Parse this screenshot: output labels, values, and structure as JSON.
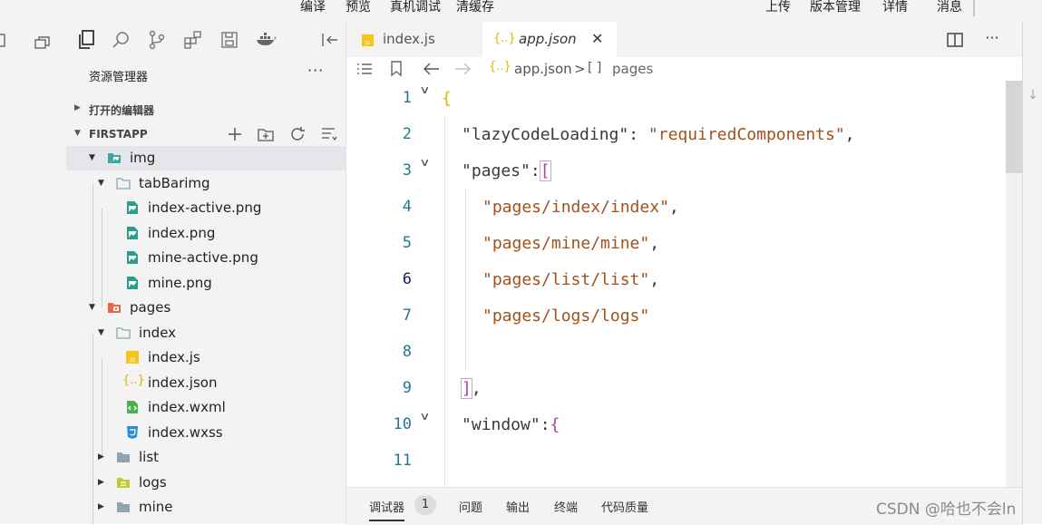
{
  "toolbar": {
    "compile": "编译",
    "preview": "预览",
    "real_debug": "真机调试",
    "clear_cache": "清缓存",
    "upload": "上传",
    "version_mgmt": "版本管理",
    "details": "详情",
    "messages": "消息"
  },
  "sidebar": {
    "title": "资源管理器",
    "more": "···",
    "open_editors": "打开的编辑器",
    "project": "FIRSTAPP",
    "tree": [
      {
        "label": "img",
        "type": "folder",
        "expanded": true
      },
      {
        "label": "tabBarimg",
        "type": "folder",
        "expanded": true
      },
      {
        "label": "index-active.png",
        "type": "image"
      },
      {
        "label": "index.png",
        "type": "image"
      },
      {
        "label": "mine-active.png",
        "type": "image"
      },
      {
        "label": "mine.png",
        "type": "image"
      },
      {
        "label": "pages",
        "type": "folder",
        "expanded": true
      },
      {
        "label": "index",
        "type": "folder",
        "expanded": true
      },
      {
        "label": "index.js",
        "type": "js"
      },
      {
        "label": "index.json",
        "type": "json"
      },
      {
        "label": "index.wxml",
        "type": "wxml"
      },
      {
        "label": "index.wxss",
        "type": "wxss"
      },
      {
        "label": "list",
        "type": "folder",
        "expanded": false
      },
      {
        "label": "logs",
        "type": "folder",
        "expanded": false
      },
      {
        "label": "mine",
        "type": "folder",
        "expanded": false
      }
    ]
  },
  "editor": {
    "tabs": [
      {
        "label": "index.js",
        "icon": "js-icon"
      },
      {
        "label": "app.json",
        "icon": "json-icon",
        "active": true
      }
    ],
    "breadcrumb": {
      "file": "app.json",
      "sep": ">",
      "node": "pages",
      "node_icon": "[ ]"
    },
    "line_numbers": [
      "1",
      "2",
      "3",
      "4",
      "5",
      "6",
      "7",
      "8",
      "9",
      "10",
      "11"
    ],
    "active_line": "6",
    "code": {
      "l1": "{",
      "l2_key": "\"lazyCodeLoading\"",
      "l2_colon": ": ",
      "l2_val": "\"requiredComponents\"",
      "l2_comma": ",",
      "l3_key": "\"pages\"",
      "l3_colon": ":",
      "l3_bracket": "[",
      "l4": "\"pages/index/index\"",
      "l5": "\"pages/mine/mine\"",
      "l6": "\"pages/list/list\"",
      "l7": "\"pages/logs/logs\"",
      "comma": ",",
      "l9_bracket": "]",
      "l9_comma": ",",
      "l10_key": "\"window\"",
      "l10_colon": ":",
      "l10_brace": "{"
    }
  },
  "bottom_panel": {
    "debugger": "调试器",
    "debugger_count": "1",
    "problems": "问题",
    "output": "输出",
    "terminal": "终端",
    "code_quality": "代码质量"
  },
  "watermark": "CSDN @哈也不会ln",
  "colors": {
    "accent_folder": "#3aa7a0",
    "folder_pages": "#e9664a",
    "js_yellow": "#f5c518",
    "json_yellow": "#e2b400",
    "string_orange": "#a0521c",
    "key_text": "#383a42",
    "line_number": "#237893"
  }
}
